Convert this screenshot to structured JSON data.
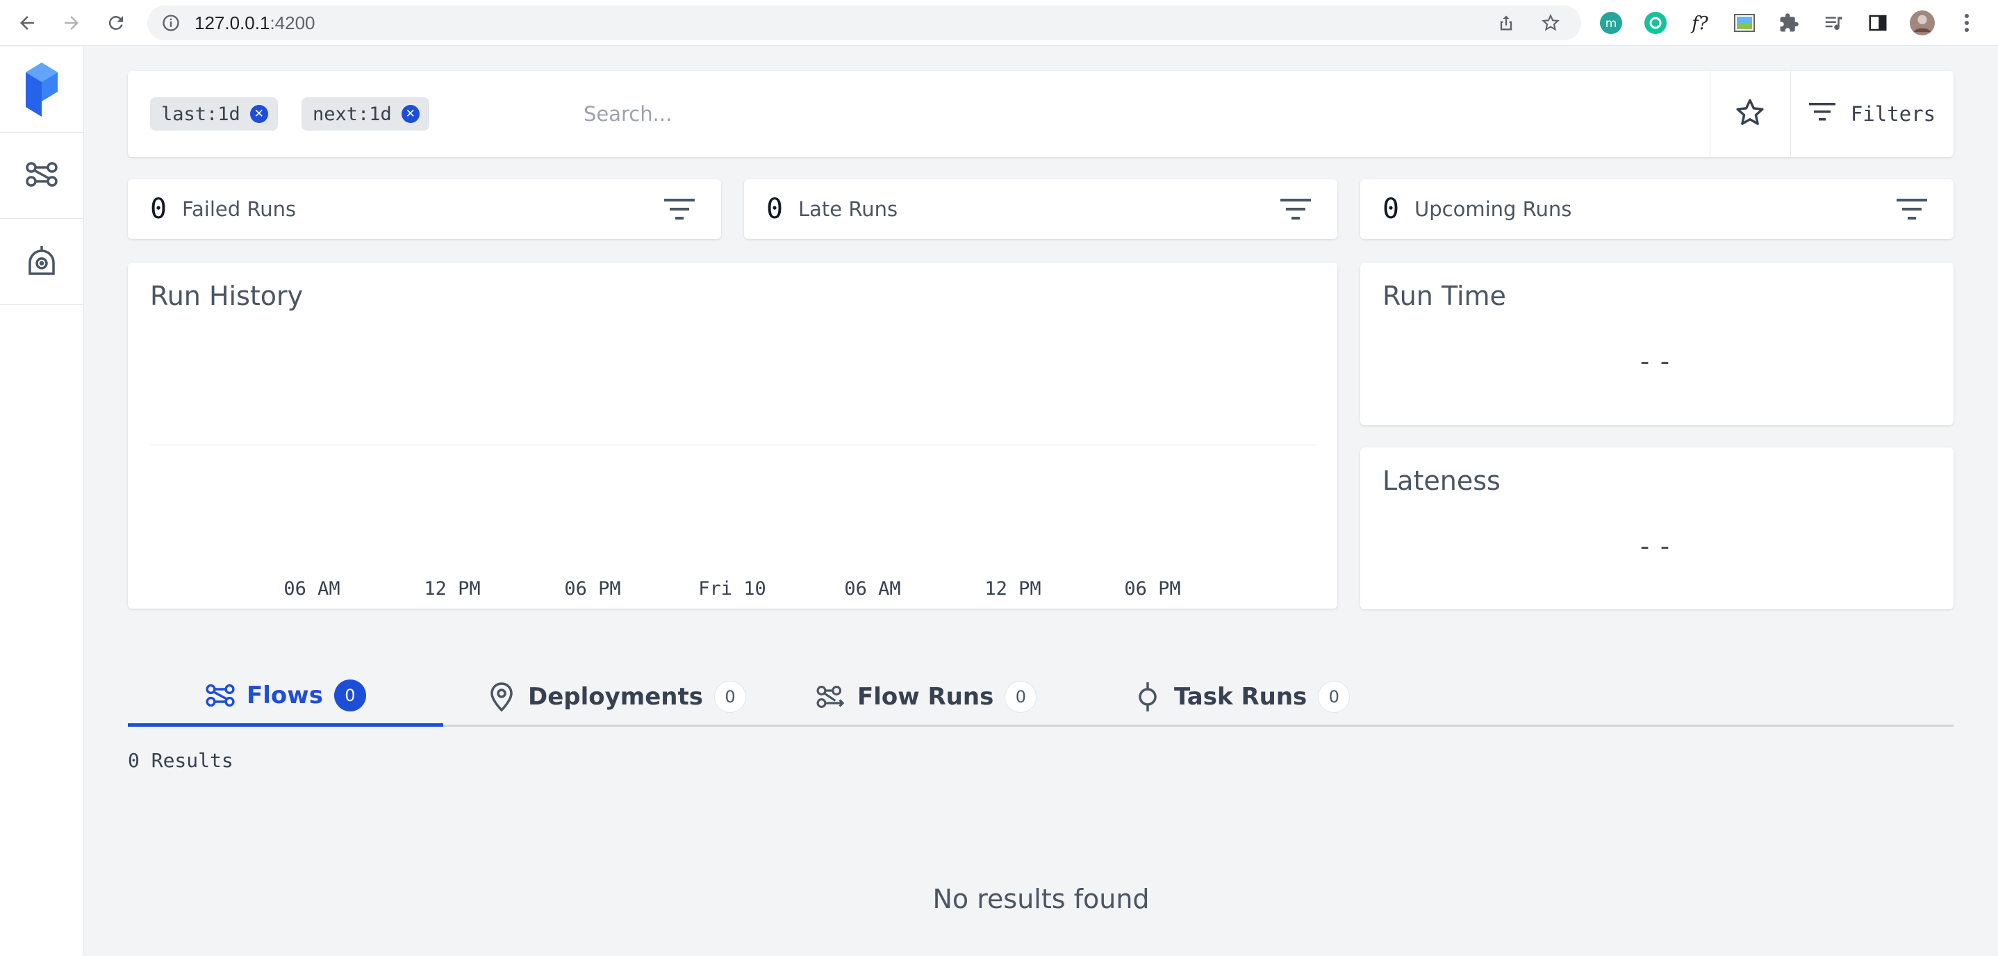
{
  "browser": {
    "url_host": "127.0.0.1",
    "url_port": ":4200"
  },
  "search": {
    "chips": [
      "last:1d",
      "next:1d"
    ],
    "placeholder": "Search...",
    "filters_label": "Filters"
  },
  "stats": [
    {
      "count": "0",
      "label": "Failed Runs"
    },
    {
      "count": "0",
      "label": "Late Runs"
    },
    {
      "count": "0",
      "label": "Upcoming Runs"
    }
  ],
  "run_history": {
    "title": "Run History",
    "x_ticks": [
      "06 AM",
      "12 PM",
      "06 PM",
      "Fri 10",
      "06 AM",
      "12 PM",
      "06 PM"
    ]
  },
  "run_time": {
    "title": "Run Time",
    "value": "--"
  },
  "lateness": {
    "title": "Lateness",
    "value": "--"
  },
  "tabs": [
    {
      "label": "Flows",
      "count": "0",
      "active": true
    },
    {
      "label": "Deployments",
      "count": "0",
      "active": false
    },
    {
      "label": "Flow Runs",
      "count": "0",
      "active": false
    },
    {
      "label": "Task Runs",
      "count": "0",
      "active": false
    }
  ],
  "results_label": "0 Results",
  "empty_message": "No results found",
  "colors": {
    "accent": "#1d4ed8",
    "brand_light": "#60a5fa",
    "brand_dark": "#2563eb"
  }
}
